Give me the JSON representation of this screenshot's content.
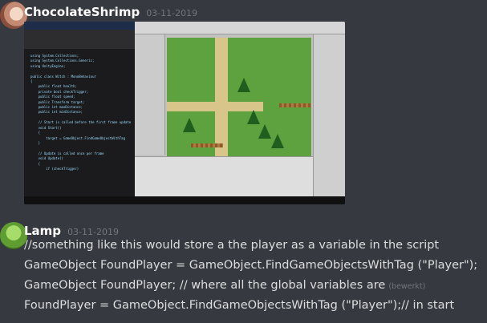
{
  "messages": [
    {
      "author": "ChocolateShrimp",
      "timestamp": "03-11-2019",
      "attachment_desc": "screenshot",
      "code_lines": [
        "using System.Collections;",
        "using System.Collections.Generic;",
        "using UnityEngine;",
        "",
        "public class Witch : MonoBehaviour",
        "{",
        "    public float health;",
        "    private bool checkTrigger;",
        "    public float speed;",
        "    public Transform target;",
        "    public int maxDistance;",
        "    public int minDistance;",
        "",
        "    // Start is called before the first frame update",
        "    void Start()",
        "    {",
        "        target = GameObject.FindGameObjectWithTag",
        "    }",
        "",
        "    // Update is called once per frame",
        "    void Update()",
        "    {",
        "        if (checkTrigger)"
      ]
    },
    {
      "author": "Lamp",
      "timestamp": "03-11-2019",
      "lines": [
        "//something like this would store a the player as a variable in the script",
        "GameObject FoundPlayer = GameObject.FindGameObjectsWithTag (\"Player\");",
        "GameObject FoundPlayer; // where all the global variables are",
        "FoundPlayer = GameObject.FindGameObjectsWithTag (\"Player\");// in start"
      ],
      "edited_label": "(bewerkt)"
    }
  ]
}
